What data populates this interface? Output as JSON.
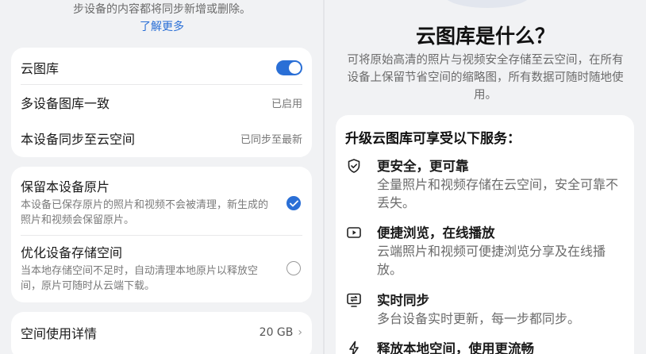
{
  "left": {
    "intro_text": "步设备的内容都将同步新增或删除。",
    "learn_more": "了解更多",
    "settings_card": {
      "cloud_gallery_label": "云图库",
      "cloud_gallery_enabled": true,
      "multi_device_label": "多设备图库一致",
      "multi_device_value": "已启用",
      "sync_label": "本设备同步至云空间",
      "sync_value": "已同步至最新"
    },
    "storage_options": {
      "keep_original_title": "保留本设备原片",
      "keep_original_desc": "本设备已保存原片的照片和视频不会被清理，新生成的照片和视频会保留原片。",
      "keep_original_selected": true,
      "optimize_title": "优化设备存储空间",
      "optimize_desc": "当本地存储空间不足时，自动清理本地原片以释放空间，原片可随时从云端下载。",
      "optimize_selected": false
    },
    "space_usage": {
      "label": "空间使用详情",
      "value": "20 GB"
    }
  },
  "right": {
    "title": "云图库是什么？",
    "description": "可将原始高清的照片与视频安全存储至云空间，在所有设备上保留节省空间的缩略图，所有数据可随时随地使用。",
    "services_title": "升级云图库可享受以下服务：",
    "features": [
      {
        "icon": "shield-icon",
        "title": "更安全，更可靠",
        "desc": "全量照片和视频存储在云空间，安全可靠不丢失。"
      },
      {
        "icon": "play-icon",
        "title": "便捷浏览，在线播放",
        "desc": "云端照片和视频可便捷浏览分享及在线播放。"
      },
      {
        "icon": "sync-icon",
        "title": "实时同步",
        "desc": "多台设备实时更新，每一步都同步。"
      },
      {
        "icon": "bolt-icon",
        "title": "释放本地空间，使用更流畅",
        "desc": ""
      }
    ]
  },
  "colors": {
    "accent": "#2a6fd6",
    "background": "#f1f2f4",
    "card": "#ffffff"
  }
}
